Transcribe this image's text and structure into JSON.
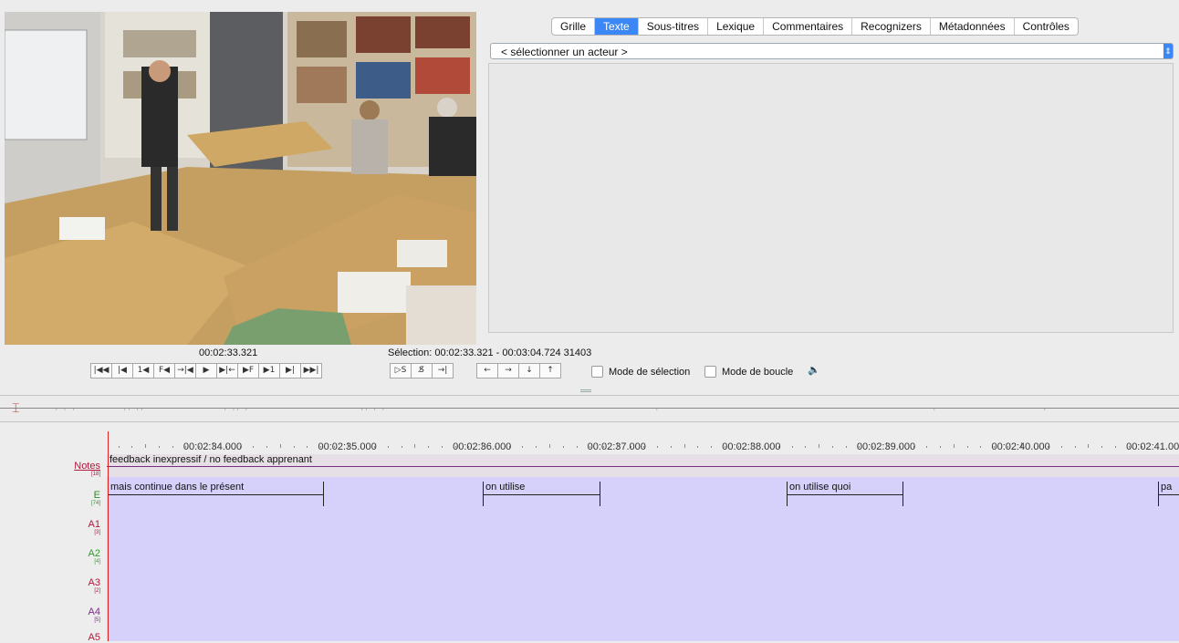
{
  "tabs": [
    "Grille",
    "Texte",
    "Sous-titres",
    "Lexique",
    "Commentaires",
    "Recognizers",
    "Métadonnées",
    "Contrôles"
  ],
  "active_tab": "Texte",
  "actor_select": {
    "value": "< sélectionner un acteur >"
  },
  "player": {
    "current_time": "00:02:33.321",
    "selection": "Sélection: 00:02:33.321 - 00:03:04.724  31403",
    "buttons_group1": [
      "|◀◀",
      "|◀",
      "1◀",
      "F◀",
      "→|◀",
      "▶",
      "▶|←",
      "▶F",
      "▶1",
      "▶|",
      "▶▶|"
    ],
    "buttons_group2": [
      "▷S",
      "S̸",
      "→|"
    ],
    "buttons_group3": [
      "←",
      "→",
      "↓",
      "↑"
    ],
    "selection_mode_label": "Mode de sélection",
    "loop_mode_label": "Mode de boucle",
    "volume_icon": "speaker-icon"
  },
  "ruler_labels": [
    "00:02:34.000",
    "00:02:35.000",
    "00:02:36.000",
    "00:02:37.000",
    "00:02:38.000",
    "00:02:39.000",
    "00:02:40.000",
    "00:02:41.000"
  ],
  "tiers": [
    {
      "name": "Notes",
      "count": "[18]",
      "color": "#b3173b"
    },
    {
      "name": "E",
      "count": "[74]",
      "color": "#2e8b2e"
    },
    {
      "name": "A1",
      "count": "[3]",
      "color": "#b3173b"
    },
    {
      "name": "A2",
      "count": "[4]",
      "color": "#2e9b2e"
    },
    {
      "name": "A3",
      "count": "[2]",
      "color": "#b3173b"
    },
    {
      "name": "A4",
      "count": "[5]",
      "color": "#7a2d85"
    },
    {
      "name": "A5",
      "count": "",
      "color": "#b3173b"
    }
  ],
  "notes_annotation": "feedback inexpressif / no feedback apprenant",
  "e_annotations": [
    "mais continue dans le présent",
    "on utilise",
    "on utilise quoi",
    "pa"
  ]
}
